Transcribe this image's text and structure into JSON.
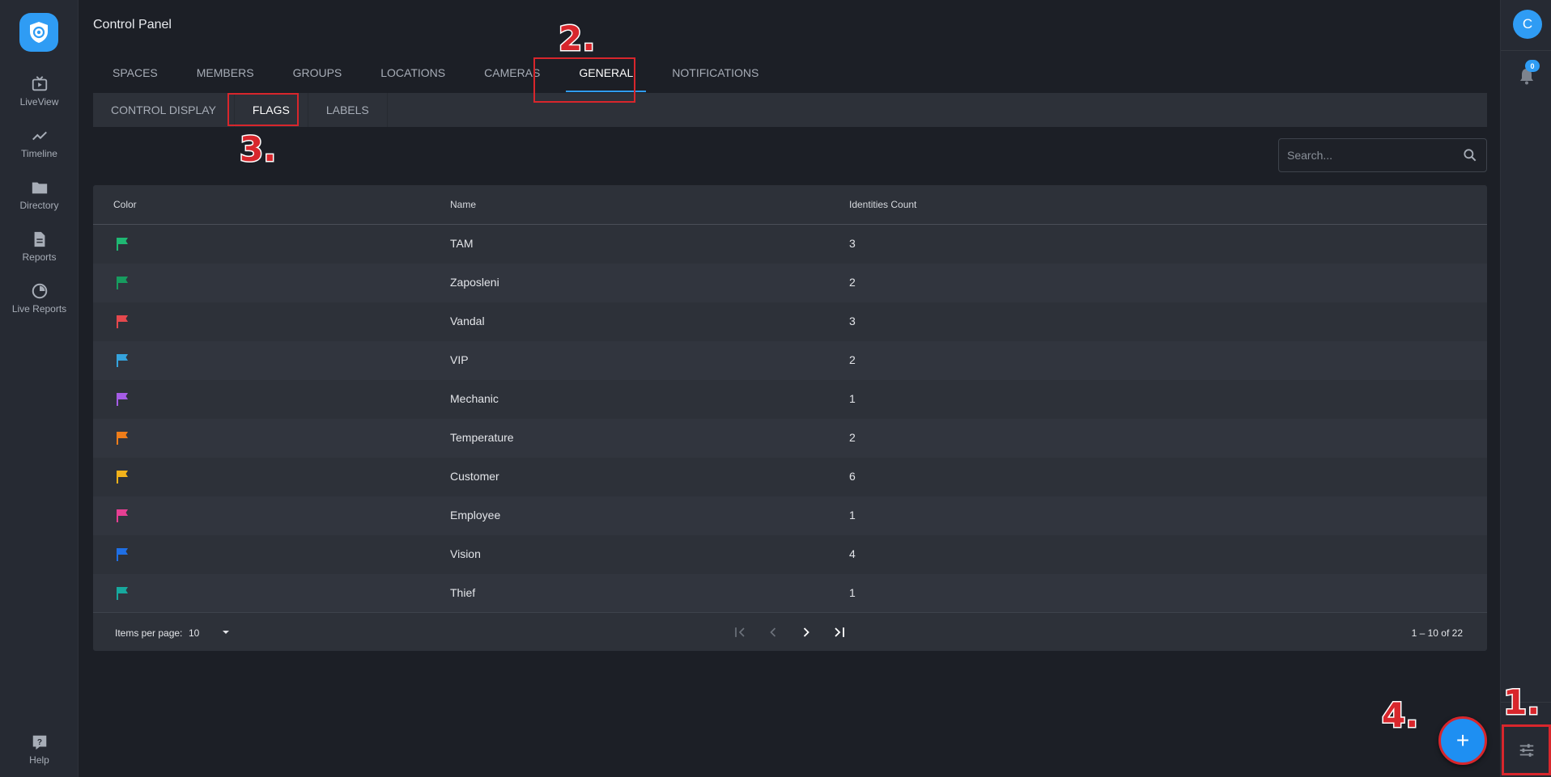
{
  "sidebar": {
    "items": [
      {
        "label": "LiveView",
        "icon": "tv-icon"
      },
      {
        "label": "Timeline",
        "icon": "trend-icon"
      },
      {
        "label": "Directory",
        "icon": "folder-icon"
      },
      {
        "label": "Reports",
        "icon": "document-icon"
      },
      {
        "label": "Live Reports",
        "icon": "pie-icon"
      }
    ],
    "help_label": "Help"
  },
  "header": {
    "title": "Control Panel"
  },
  "tabs": [
    "SPACES",
    "MEMBERS",
    "GROUPS",
    "LOCATIONS",
    "CAMERAS",
    "GENERAL",
    "NOTIFICATIONS"
  ],
  "active_tab": "GENERAL",
  "subtabs": [
    "CONTROL DISPLAY",
    "FLAGS",
    "LABELS"
  ],
  "active_subtab": "FLAGS",
  "search": {
    "placeholder": "Search..."
  },
  "table": {
    "columns": [
      "Color",
      "Name",
      "Identities Count"
    ],
    "rows": [
      {
        "color": "#1fb873",
        "name": "TAM",
        "count": "3"
      },
      {
        "color": "#179c5f",
        "name": "Zaposleni",
        "count": "2"
      },
      {
        "color": "#e5484d",
        "name": "Vandal",
        "count": "3"
      },
      {
        "color": "#35a3dd",
        "name": "VIP",
        "count": "2"
      },
      {
        "color": "#a55ce6",
        "name": "Mechanic",
        "count": "1"
      },
      {
        "color": "#ef7d1a",
        "name": "Temperature",
        "count": "2"
      },
      {
        "color": "#f2b21b",
        "name": "Customer",
        "count": "6"
      },
      {
        "color": "#e63f93",
        "name": "Employee",
        "count": "1"
      },
      {
        "color": "#1f6fe5",
        "name": "Vision",
        "count": "4"
      },
      {
        "color": "#17a99e",
        "name": "Thief",
        "count": "1"
      }
    ]
  },
  "pagination": {
    "items_per_page_label": "Items per page:",
    "items_per_page": "10",
    "range": "1 – 10 of 22"
  },
  "user": {
    "avatar_letter": "C"
  },
  "notifications": {
    "count": "0"
  },
  "annotations": [
    "1.",
    "2.",
    "3.",
    "4."
  ]
}
